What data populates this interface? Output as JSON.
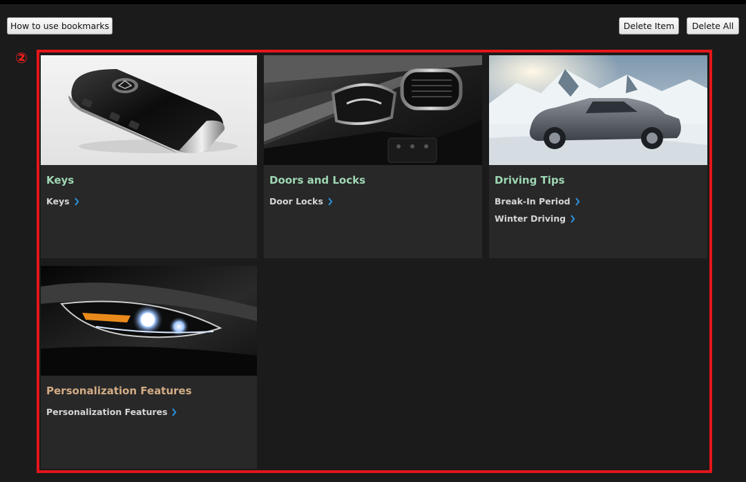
{
  "toolbar": {
    "how_to_label": "How to use bookmarks",
    "delete_item_label": "Delete Item",
    "delete_all_label": "Delete All"
  },
  "callout": {
    "number": "②"
  },
  "colors": {
    "background": "#1b1b1b",
    "card": "#282828",
    "highlight_frame": "#e5151b",
    "title_green": "#9fd8b4",
    "title_amber": "#d3ac86",
    "chevron": "#2a8fd8"
  },
  "cards": [
    {
      "image": "smart-key-photo",
      "title": "Keys",
      "links": [
        "Keys"
      ]
    },
    {
      "image": "door-interior-photo",
      "title": "Doors and Locks",
      "links": [
        "Door Locks"
      ]
    },
    {
      "image": "snow-suv-photo",
      "title": "Driving Tips",
      "links": [
        "Break-In Period",
        "Winter Driving"
      ]
    },
    {
      "image": "headlight-photo",
      "title": "Personalization Features",
      "links": [
        "Personalization Features"
      ]
    }
  ]
}
